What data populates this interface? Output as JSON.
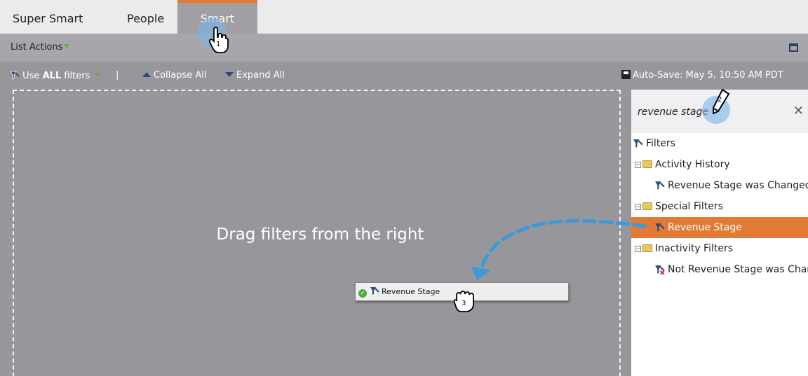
{
  "tabs": [
    {
      "label": "Super Smart List"
    },
    {
      "label": "People"
    },
    {
      "label": "Smart List"
    }
  ],
  "actions_bar": {
    "list_actions": "List Actions"
  },
  "toolbar": {
    "use_prefix": "Use ",
    "use_bold": "ALL",
    "use_suffix": " filters",
    "separator": "|",
    "collapse": "Collapse All",
    "expand": "Expand All",
    "autosave": "Auto-Save: May 5, 10:50 AM PDT"
  },
  "dropzone": {
    "hint": "Drag filters from the right"
  },
  "dragged": {
    "label": "Revenue Stage"
  },
  "panel": {
    "search_value": "revenue stage",
    "tree": {
      "root": "Filters",
      "activity_history": "Activity History",
      "rev_changed": "Revenue Stage was Changed",
      "special_filters": "Special Filters",
      "revenue_stage": "Revenue Stage",
      "inactivity_filters": "Inactivity Filters",
      "not_rev_changed": "Not Revenue Stage was Changed"
    }
  },
  "annotations": {
    "step1": "1",
    "step2": "2",
    "step3": "3"
  },
  "colors": {
    "accent": "#e07a35",
    "arrow": "#3b9ad9",
    "tab_active_border": "#e8772e"
  }
}
